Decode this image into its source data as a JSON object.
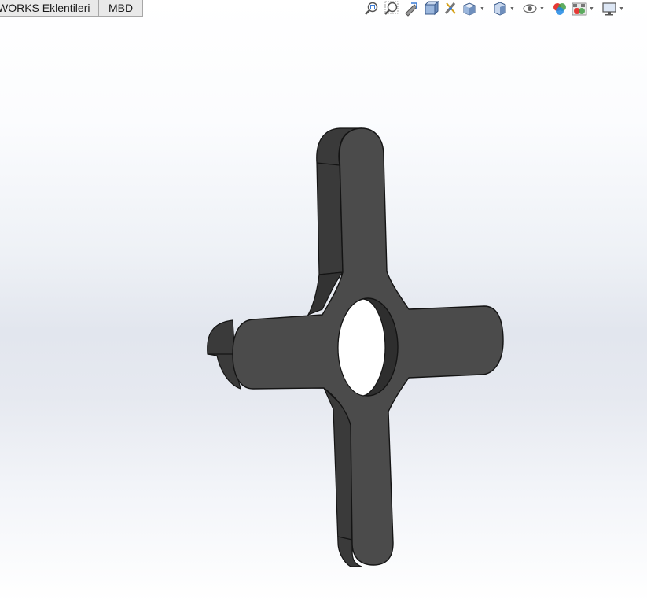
{
  "command_manager": {
    "tabs": [
      {
        "label": "WORKS Eklentileri"
      },
      {
        "label": "MBD"
      }
    ]
  },
  "heads_up_toolbar": {
    "buttons": [
      {
        "icon": "zoom-to-fit-icon"
      },
      {
        "icon": "zoom-to-area-icon"
      },
      {
        "icon": "previous-view-icon"
      },
      {
        "icon": "section-view-icon"
      },
      {
        "icon": "dynamic-annotation-views-icon"
      },
      {
        "icon": "view-orientation-icon",
        "has_dropdown": true
      },
      {
        "icon": "display-style-icon",
        "has_dropdown": true
      },
      {
        "icon": "hide-show-items-icon",
        "has_dropdown": true
      },
      {
        "icon": "edit-appearance-icon"
      },
      {
        "icon": "apply-scene-icon",
        "has_dropdown": true
      },
      {
        "icon": "view-settings-icon",
        "has_dropdown": true
      }
    ]
  },
  "colors": {
    "part_face": "#4b4b4b",
    "part_side": "#3a3a3a",
    "part_edge": "#141414",
    "background_top": "#ffffff",
    "background_mid": "#e2e6ee"
  }
}
